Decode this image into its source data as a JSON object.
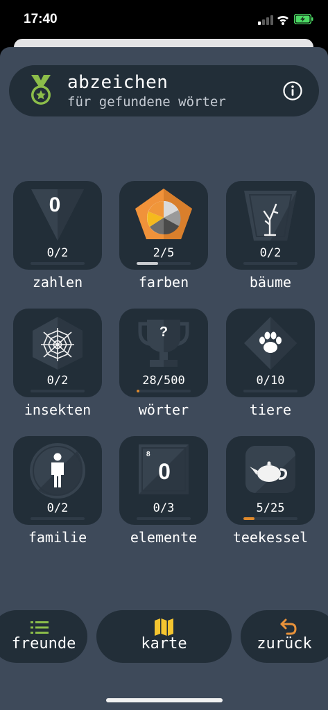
{
  "status_bar": {
    "time": "17:40"
  },
  "header": {
    "title": "abzeichen",
    "subtitle": "für gefundene wörter",
    "icons": {
      "medal": "medal-icon",
      "info": "info-icon"
    },
    "accent_color": "#8cbd4a"
  },
  "badges": [
    {
      "id": "zahlen",
      "label": "zahlen",
      "count": "0/2",
      "progress": 0,
      "symbol": "0"
    },
    {
      "id": "farben",
      "label": "farben",
      "count": "2/5",
      "progress": 0.4,
      "bar_color": "#c9ccd0"
    },
    {
      "id": "baeume",
      "label": "bäume",
      "count": "0/2",
      "progress": 0
    },
    {
      "id": "insekten",
      "label": "insekten",
      "count": "0/2",
      "progress": 0
    },
    {
      "id": "woerter",
      "label": "wörter",
      "count": "28/500",
      "progress": 0.056,
      "bar_color": "#e08a2c",
      "symbol": "?"
    },
    {
      "id": "tiere",
      "label": "tiere",
      "count": "0/10",
      "progress": 0
    },
    {
      "id": "familie",
      "label": "familie",
      "count": "0/2",
      "progress": 0
    },
    {
      "id": "elemente",
      "label": "elemente",
      "count": "0/3",
      "progress": 0,
      "symbol": "0",
      "atomic_number": "8"
    },
    {
      "id": "teekessel",
      "label": "teekessel",
      "count": "5/25",
      "progress": 0.2,
      "bar_color": "#e08a2c"
    }
  ],
  "bottom_nav": [
    {
      "id": "freunde",
      "label": "freunde",
      "icon": "list-icon",
      "icon_color": "#8cbd4a"
    },
    {
      "id": "karte",
      "label": "karte",
      "icon": "map-icon",
      "icon_color": "#f5c530"
    },
    {
      "id": "zurueck",
      "label": "zurück",
      "icon": "back-arrow-icon",
      "icon_color": "#e8923a"
    }
  ]
}
